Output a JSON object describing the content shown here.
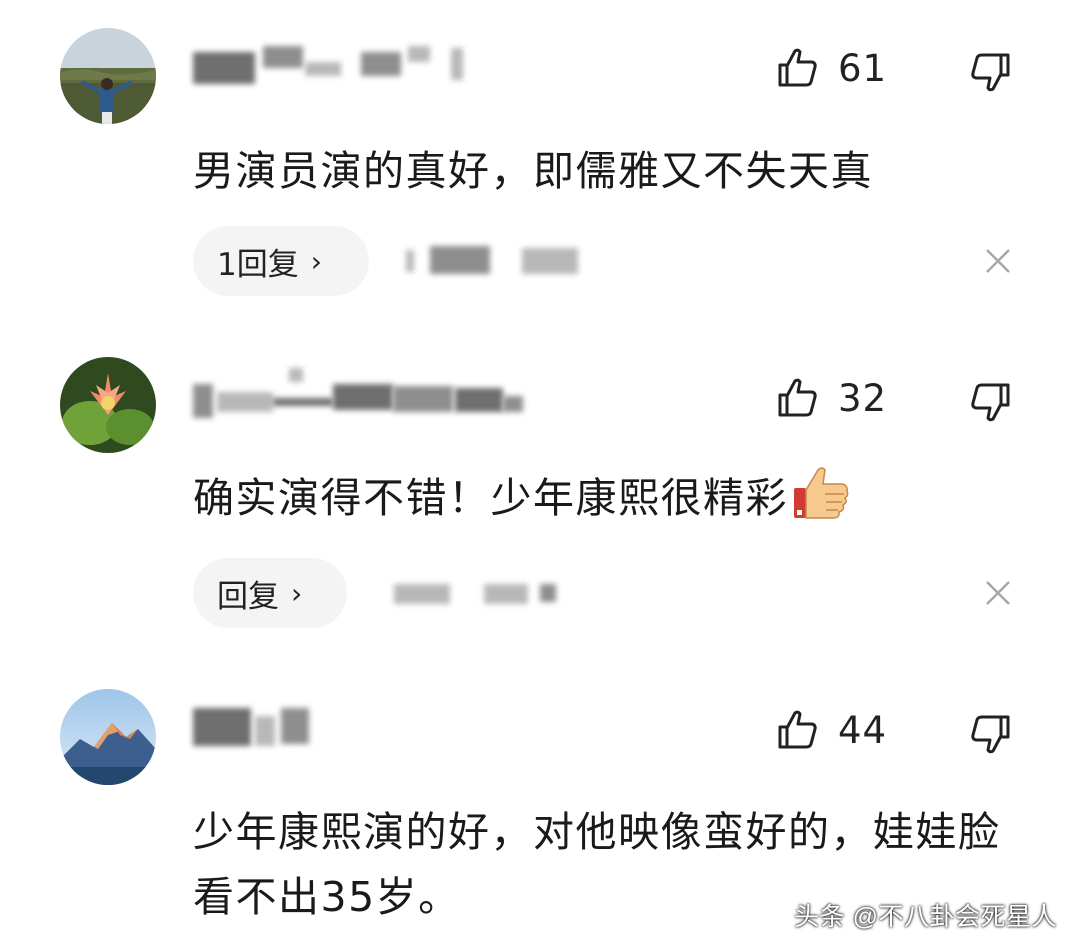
{
  "comments": [
    {
      "like_count": "61",
      "text": "男演员演的真好，即儒雅又不失天真",
      "reply_label": "1回复",
      "reply_chevron": "›"
    },
    {
      "like_count": "32",
      "text": "确实演得不错！少年康熙很精彩",
      "reply_label": "回复",
      "reply_chevron": "›"
    },
    {
      "like_count": "44",
      "text": "少年康熙演的好，对他映像蛮好的，娃娃脸看不出35岁。"
    }
  ],
  "watermark": "头条 @不八卦会死星人",
  "icons": {
    "like": "thumbs-up-outline-icon",
    "dislike": "thumbs-down-outline-icon",
    "close": "close-icon",
    "emoji": "thumbs-up-emoji"
  },
  "colors": {
    "text": "#1a1a1a",
    "reply_pill": "#f4f4f4",
    "icon": "#222222",
    "close": "#a8a8a8"
  }
}
